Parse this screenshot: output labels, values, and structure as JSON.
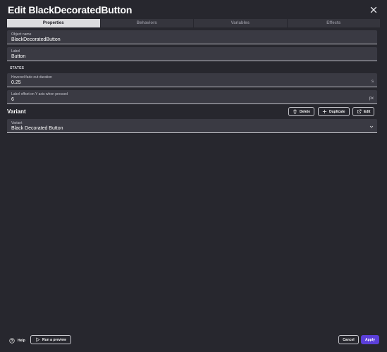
{
  "dialog": {
    "title": "Edit BlackDecoratedButton"
  },
  "tabs": [
    {
      "label": "Properties",
      "active": true
    },
    {
      "label": "Behaviors",
      "active": false
    },
    {
      "label": "Variables",
      "active": false
    },
    {
      "label": "Effects",
      "active": false
    }
  ],
  "fields": {
    "object_name": {
      "label": "Object name",
      "value": "BlackDecoratedButton"
    },
    "label": {
      "label": "Label",
      "value": "Button"
    },
    "states_heading": "STATES",
    "hovered_fade": {
      "label": "Hovered fade out duration",
      "value": "0.25",
      "unit": "s"
    },
    "label_offset": {
      "label": "Label offset on Y axis when pressed",
      "value": "6",
      "unit": "px"
    }
  },
  "variant": {
    "heading": "Variant",
    "delete_label": "Delete",
    "duplicate_label": "Duplicate",
    "edit_label": "Edit",
    "select_label": "Variant",
    "select_value": "Black Decorated Button"
  },
  "footer": {
    "help_label": "Help",
    "preview_label": "Run a preview",
    "cancel_label": "Cancel",
    "apply_label": "Apply"
  },
  "colors": {
    "background": "#27272e",
    "field": "#3a3a43",
    "accent": "#5b3fd9",
    "active_tab": "#dcdcdf"
  },
  "icons": {
    "close": "close-icon",
    "delete": "trash-icon",
    "duplicate": "plus-icon",
    "edit": "external-link-icon",
    "dropdown": "chevron-down-icon",
    "help": "help-circle-icon",
    "preview": "play-icon"
  }
}
